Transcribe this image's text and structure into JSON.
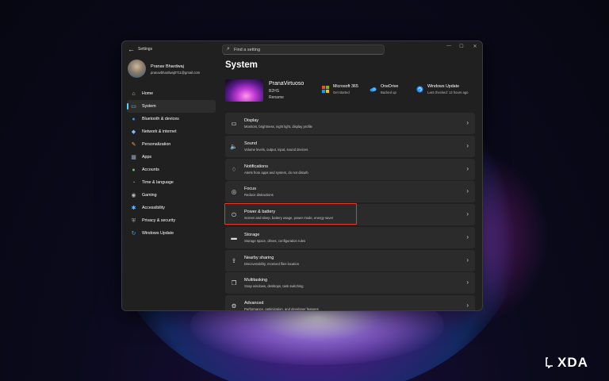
{
  "window": {
    "app_title": "Settings",
    "back_glyph": "←",
    "minimize_glyph": "—",
    "maximize_glyph": "☐",
    "close_glyph": "✕"
  },
  "search": {
    "placeholder": "Find a setting",
    "icon": "search-icon"
  },
  "profile": {
    "name": "Pranav Bhardwaj",
    "email": "pranavbhardwaj0711@gmail.com"
  },
  "sidebar": {
    "items": [
      {
        "label": "Home",
        "icon": "home-icon",
        "glyph": "⌂",
        "color": "#e8c07d"
      },
      {
        "label": "System",
        "icon": "system-monitor-icon",
        "glyph": "▭",
        "color": "#60cdff"
      },
      {
        "label": "Bluetooth & devices",
        "icon": "bluetooth-icon",
        "glyph": "●",
        "color": "#3b8cff"
      },
      {
        "label": "Network & internet",
        "icon": "network-icon",
        "glyph": "◆",
        "color": "#8ab4f8"
      },
      {
        "label": "Personalization",
        "icon": "brush-icon",
        "glyph": "✎",
        "color": "#f5a05a"
      },
      {
        "label": "Apps",
        "icon": "apps-icon",
        "glyph": "▦",
        "color": "#9aa7bd"
      },
      {
        "label": "Accounts",
        "icon": "accounts-icon",
        "glyph": "●",
        "color": "#5fc47a"
      },
      {
        "label": "Time & language",
        "icon": "globe-clock-icon",
        "glyph": "◔",
        "color": "#5aa9e6"
      },
      {
        "label": "Gaming",
        "icon": "gamepad-icon",
        "glyph": "◉",
        "color": "#b5b5b5"
      },
      {
        "label": "Accessibility",
        "icon": "accessibility-icon",
        "glyph": "✱",
        "color": "#6cb8ff"
      },
      {
        "label": "Privacy & security",
        "icon": "shield-icon",
        "glyph": "⛨",
        "color": "#a0a0a0"
      },
      {
        "label": "Windows Update",
        "icon": "windows-update-icon",
        "glyph": "↻",
        "color": "#3aa0ff"
      }
    ],
    "active_index": 1
  },
  "main": {
    "title": "System",
    "device": {
      "name": "PranaVirtuoso",
      "model": "B2HS",
      "rename": "Rename"
    },
    "quick_links": [
      {
        "title": "Microsoft 365",
        "subtitle": "Get started",
        "icon": "microsoft-365-icon"
      },
      {
        "title": "OneDrive",
        "subtitle": "Backed up",
        "icon": "onedrive-cloud-icon"
      },
      {
        "title": "Windows Update",
        "subtitle": "Last checked: 12 hours ago",
        "icon": "windows-update-icon"
      }
    ],
    "settings": [
      {
        "title": "Display",
        "subtitle": "Monitors, brightness, night light, display profile",
        "icon": "display-icon",
        "glyph": "▭"
      },
      {
        "title": "Sound",
        "subtitle": "Volume levels, output, input, sound devices",
        "icon": "speaker-icon",
        "glyph": "🔈"
      },
      {
        "title": "Notifications",
        "subtitle": "Alerts from apps and system, do not disturb",
        "icon": "bell-icon",
        "glyph": "♢"
      },
      {
        "title": "Focus",
        "subtitle": "Reduce distractions",
        "icon": "focus-icon",
        "glyph": "◎"
      },
      {
        "title": "Power & battery",
        "subtitle": "Screen and sleep, battery usage, power mode, energy saver",
        "icon": "power-icon",
        "glyph": "⏻"
      },
      {
        "title": "Storage",
        "subtitle": "Storage space, drives, configuration rules",
        "icon": "storage-drive-icon",
        "glyph": "▬"
      },
      {
        "title": "Nearby sharing",
        "subtitle": "Discoverability, received files location",
        "icon": "share-icon",
        "glyph": "⇪"
      },
      {
        "title": "Multitasking",
        "subtitle": "Snap windows, desktops, task switching",
        "icon": "multitasking-icon",
        "glyph": "❐"
      },
      {
        "title": "Advanced",
        "subtitle": "Performance, optimization, and developer features",
        "icon": "advanced-icon",
        "glyph": "⚙"
      }
    ],
    "chevron": "›",
    "highlighted_item": "Power & battery",
    "highlight_color": "#e8392b"
  },
  "watermark": {
    "text": "XDA"
  },
  "colors": {
    "accent": "#60cdff",
    "window_bg": "#202020",
    "card_bg": "#2b2b2b"
  }
}
